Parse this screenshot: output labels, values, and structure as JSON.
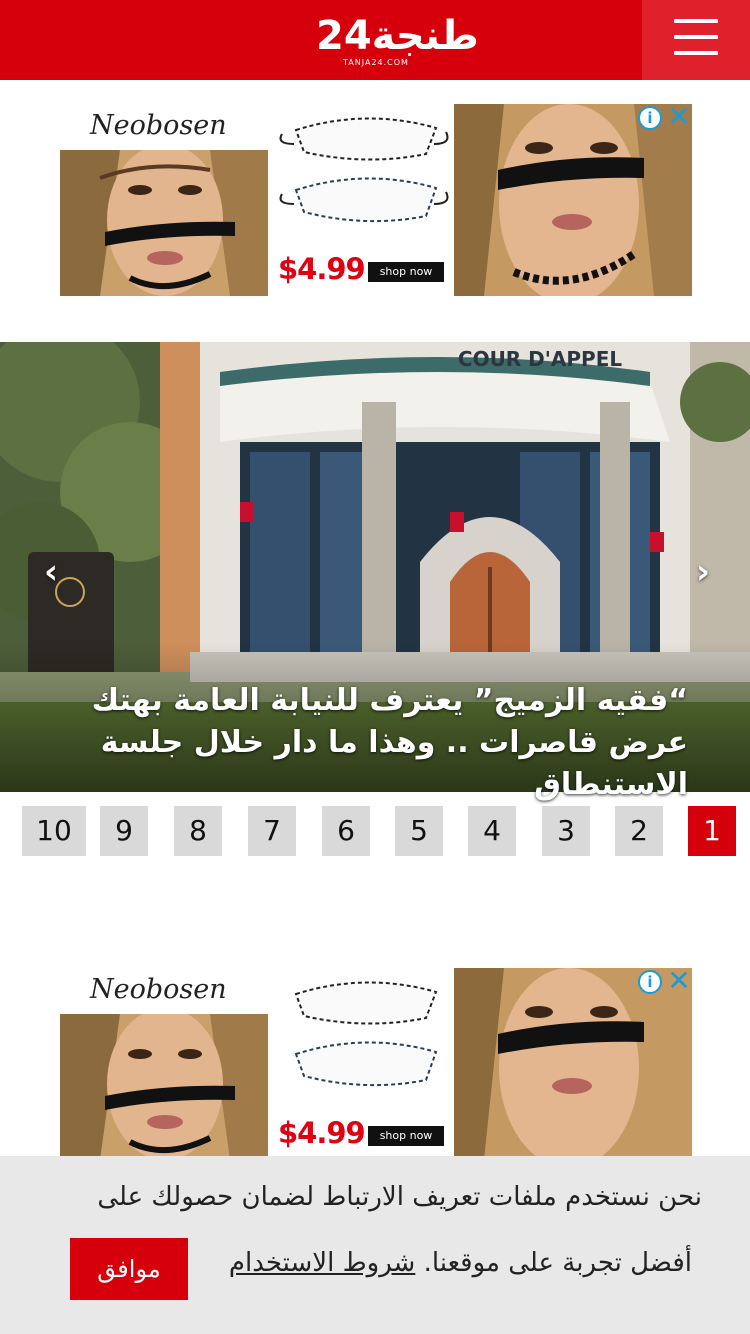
{
  "header": {
    "logo_main": "طنجة24",
    "logo_sub": "TANJA24.COM",
    "brand_color": "#d6000d",
    "menu_icon": "hamburger-menu-icon"
  },
  "ads": [
    {
      "brand": "Neobosen",
      "price": "$4.99",
      "shop_label": "shop now",
      "info_icon": "info-icon",
      "close_icon": "close-icon"
    },
    {
      "brand": "Neobosen",
      "price": "$4.99",
      "shop_label": "shop now",
      "info_icon": "info-icon",
      "close_icon": "close-icon"
    }
  ],
  "slider": {
    "building_sign": "COUR D'APPEL",
    "caption": "“فقيه الزميج” يعترف للنيابة العامة بهتك عرض قاصرات .. وهذا ما دار خلال جلسة الاستنطاق",
    "prev_icon": "chevron-left-icon",
    "next_icon": "chevron-right-icon",
    "prev_label": "‹",
    "next_label": "›"
  },
  "pagination": {
    "pages": [
      "1",
      "2",
      "3",
      "4",
      "5",
      "6",
      "7",
      "8",
      "9",
      "10"
    ],
    "active": "1"
  },
  "cookie": {
    "line1": "نحن نستخدم ملفات تعريف الارتباط لضمان حصولك على",
    "line2": "أفضل تجربة على موقعنا.",
    "link": "شروط الاستخدام",
    "accept": "موافق"
  }
}
